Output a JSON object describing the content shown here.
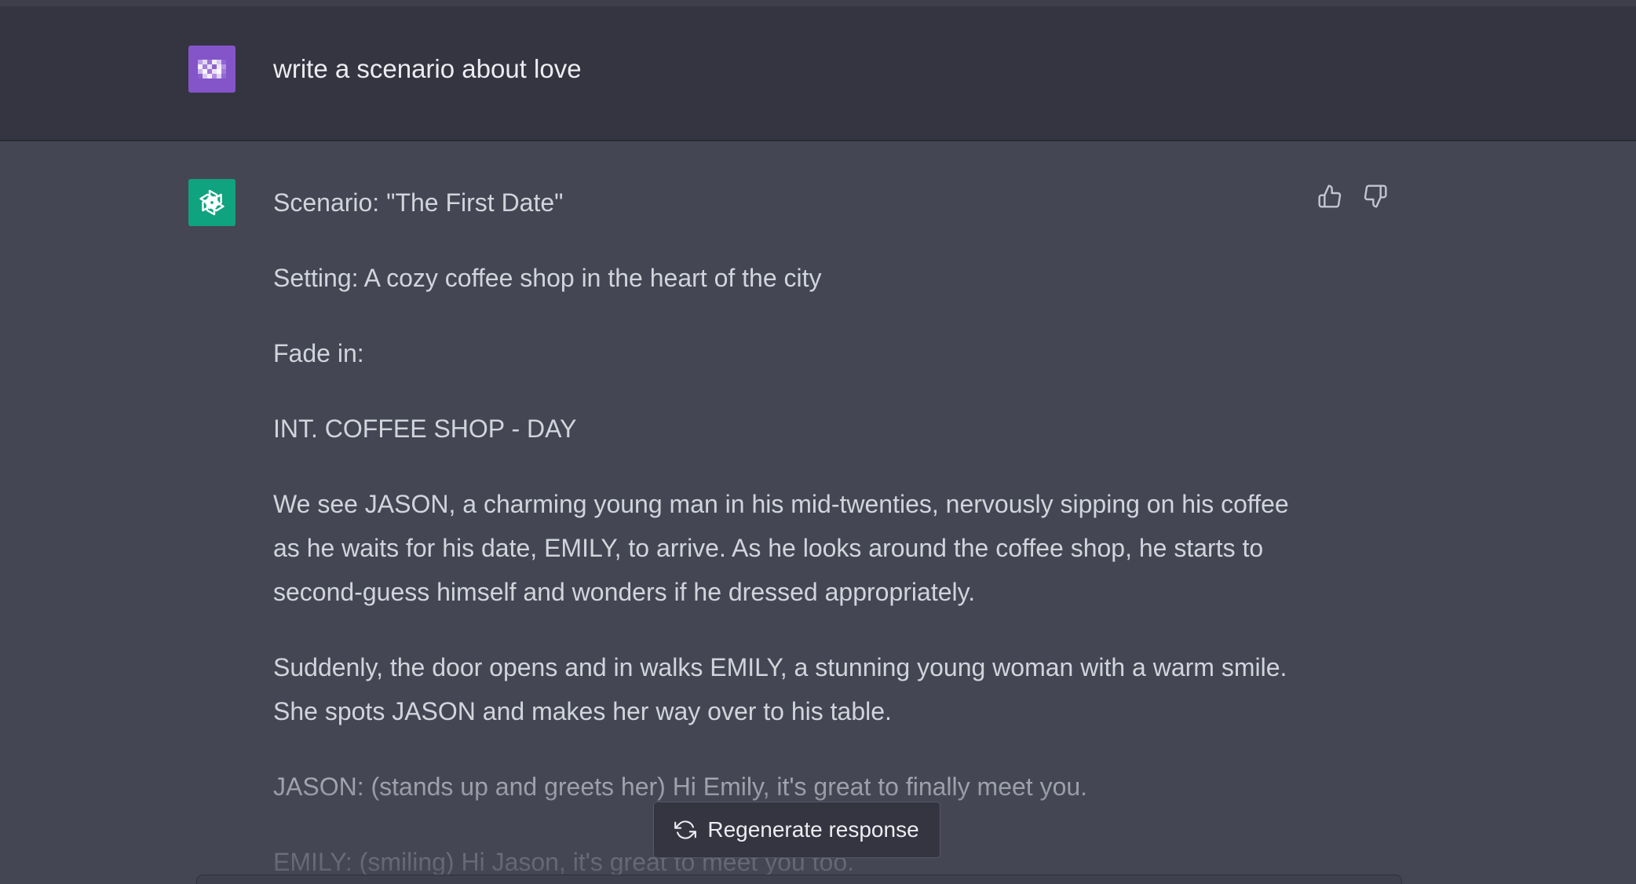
{
  "user_message": {
    "text": "write a scenario about love",
    "avatar_icon": "user-avatar-icon",
    "avatar_color": "#8454c9"
  },
  "assistant_message": {
    "avatar_icon": "openai-logo-icon",
    "avatar_color": "#10a37f",
    "paragraphs": [
      "Scenario: \"The First Date\"",
      "Setting: A cozy coffee shop in the heart of the city",
      "Fade in:",
      "INT. COFFEE SHOP - DAY",
      "We see JASON, a charming young man in his mid-twenties, nervously sipping on his coffee as he waits for his date, EMILY, to arrive. As he looks around the coffee shop, he starts to second-guess himself and wonders if he dressed appropriately.",
      "Suddenly, the door opens and in walks EMILY, a stunning young woman with a warm smile. She spots JASON and makes her way over to his table.",
      "JASON: (stands up and greets her) Hi Emily, it's great to finally meet you.",
      "EMILY: (smiling) Hi Jason, it's great to meet you too."
    ],
    "feedback": {
      "thumbs_up_icon": "thumbs-up-icon",
      "thumbs_down_icon": "thumbs-down-icon"
    }
  },
  "regenerate": {
    "label": "Regenerate response",
    "icon": "refresh-icon"
  },
  "colors": {
    "user_bg": "#343541",
    "assistant_bg": "#444654",
    "text": "#d1d5db"
  }
}
